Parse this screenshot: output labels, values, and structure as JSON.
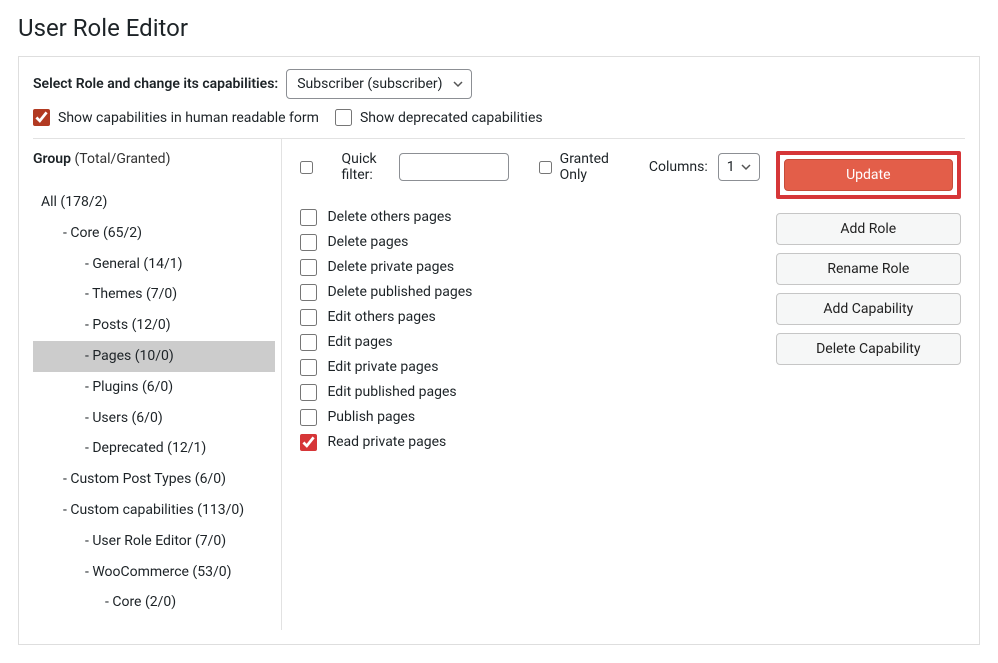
{
  "page_title": "User Role Editor",
  "top": {
    "label": "Select Role and change its capabilities:",
    "role_selected": "Subscriber (subscriber)"
  },
  "options": {
    "human_readable_label": "Show capabilities in human readable form",
    "human_readable_checked": true,
    "deprecated_label": "Show deprecated capabilities",
    "deprecated_checked": false
  },
  "group": {
    "label": "Group",
    "counts_label": "(Total/Granted)"
  },
  "tree": [
    {
      "label": "All (178/2)",
      "level": 0,
      "selected": false
    },
    {
      "label": "- Core (65/2)",
      "level": 1,
      "selected": false
    },
    {
      "label": "- General (14/1)",
      "level": 2,
      "selected": false
    },
    {
      "label": "- Themes (7/0)",
      "level": 2,
      "selected": false
    },
    {
      "label": "- Posts (12/0)",
      "level": 2,
      "selected": false
    },
    {
      "label": "- Pages (10/0)",
      "level": 2,
      "selected": true
    },
    {
      "label": "- Plugins (6/0)",
      "level": 2,
      "selected": false
    },
    {
      "label": "- Users (6/0)",
      "level": 2,
      "selected": false
    },
    {
      "label": "- Deprecated (12/1)",
      "level": 2,
      "selected": false
    },
    {
      "label": "- Custom Post Types (6/0)",
      "level": 1,
      "selected": false
    },
    {
      "label": "- Custom capabilities (113/0)",
      "level": 1,
      "selected": false
    },
    {
      "label": "- User Role Editor (7/0)",
      "level": 2,
      "selected": false
    },
    {
      "label": "- WooCommerce (53/0)",
      "level": 2,
      "selected": false
    },
    {
      "label": "- Core (2/0)",
      "level": 3,
      "selected": false
    }
  ],
  "filter": {
    "quick_filter_label": "Quick filter:",
    "granted_only_label": "Granted Only",
    "columns_label": "Columns:",
    "columns_value": "1"
  },
  "caps": [
    {
      "label": "Delete others pages",
      "checked": false
    },
    {
      "label": "Delete pages",
      "checked": false
    },
    {
      "label": "Delete private pages",
      "checked": false
    },
    {
      "label": "Delete published pages",
      "checked": false
    },
    {
      "label": "Edit others pages",
      "checked": false
    },
    {
      "label": "Edit pages",
      "checked": false
    },
    {
      "label": "Edit private pages",
      "checked": false
    },
    {
      "label": "Edit published pages",
      "checked": false
    },
    {
      "label": "Publish pages",
      "checked": false
    },
    {
      "label": "Read private pages",
      "checked": true
    }
  ],
  "buttons": {
    "update": "Update",
    "add_role": "Add Role",
    "rename_role": "Rename Role",
    "add_capability": "Add Capability",
    "delete_capability": "Delete Capability"
  }
}
